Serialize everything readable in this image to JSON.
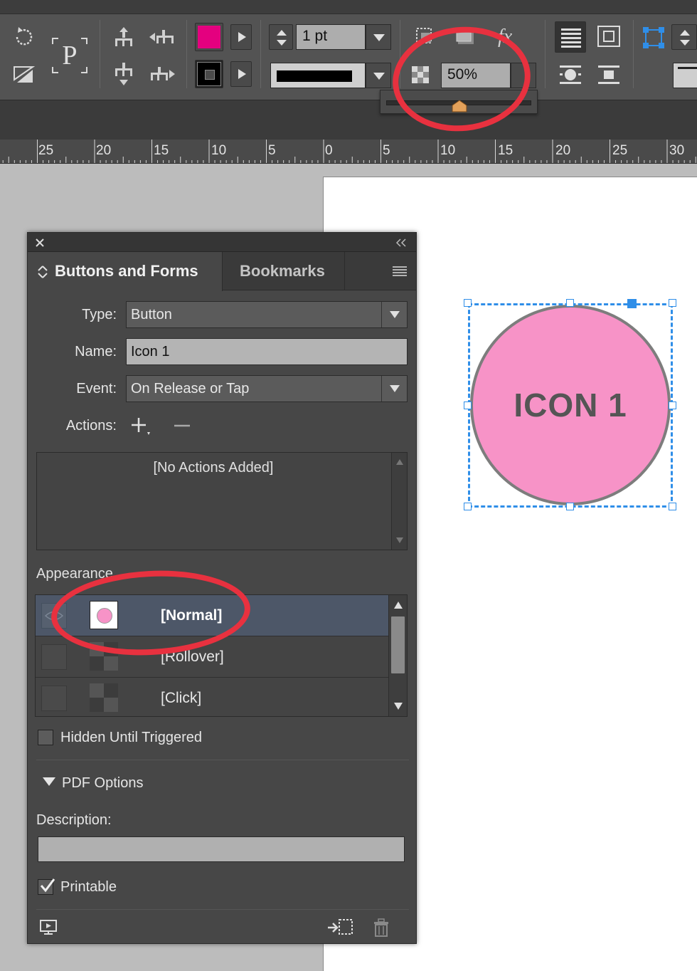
{
  "control_bar": {
    "stroke_weight": "1 pt",
    "opacity": "50%",
    "fill_color": "#e4007f",
    "stroke_color": "#000000"
  },
  "ruler": {
    "labels": [
      "25",
      "20",
      "15",
      "10",
      "5",
      "0",
      "5",
      "10",
      "15",
      "20",
      "25",
      "30"
    ]
  },
  "panel": {
    "tab_active": "Buttons and Forms",
    "tab_inactive": "Bookmarks",
    "type_label": "Type:",
    "type_value": "Button",
    "name_label": "Name:",
    "name_value": "Icon 1",
    "event_label": "Event:",
    "event_value": "On Release or Tap",
    "actions_label": "Actions:",
    "no_actions": "[No Actions Added]",
    "appearance_label": "Appearance",
    "states": [
      {
        "name": "[Normal]"
      },
      {
        "name": "[Rollover]"
      },
      {
        "name": "[Click]"
      }
    ],
    "hidden_label": "Hidden Until Triggered",
    "pdf_options_label": "PDF Options",
    "description_label": "Description:",
    "description_value": "",
    "printable_label": "Printable"
  },
  "canvas": {
    "button_text": "ICON 1",
    "button_fill": "#f793c7",
    "selection_color": "#2f8ee8"
  },
  "annotation_color": "#e8313f"
}
